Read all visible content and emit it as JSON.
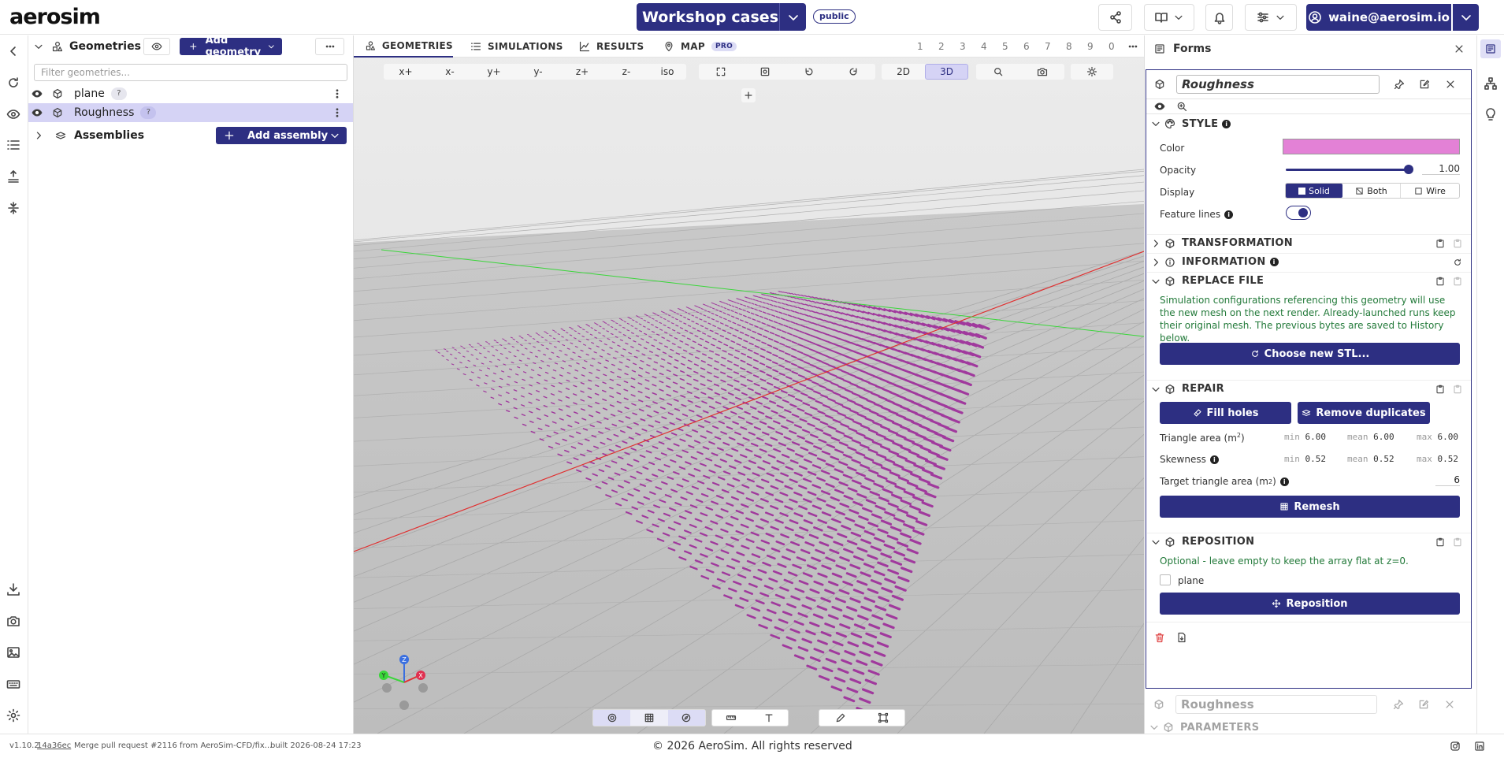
{
  "topbar": {
    "logo": "aerosim",
    "project_title": "Workshop cases",
    "visibility_badge": "public",
    "user_email": "waine@aerosim.io"
  },
  "geometries_panel": {
    "title": "Geometries",
    "add_geometry_label": "Add geometry",
    "filter_placeholder": "Filter geometries...",
    "items": [
      {
        "name": "plane",
        "badge": "?"
      },
      {
        "name": "Roughness",
        "badge": "?"
      }
    ],
    "assemblies_label": "Assemblies",
    "add_assembly_label": "Add assembly"
  },
  "viewport": {
    "tabs": [
      {
        "label": "GEOMETRIES"
      },
      {
        "label": "SIMULATIONS"
      },
      {
        "label": "RESULTS"
      },
      {
        "label": "MAP",
        "badge": "PRO"
      }
    ],
    "numbers": [
      "1",
      "2",
      "3",
      "4",
      "5",
      "6",
      "7",
      "8",
      "9",
      "0"
    ],
    "view_buttons": [
      "x+",
      "x-",
      "y+",
      "y-",
      "z+",
      "z-",
      "iso"
    ],
    "mode_2d": "2D",
    "mode_3d": "3D",
    "axis_labels": {
      "z": "Z",
      "y": "Y",
      "x": "X"
    },
    "colors": {
      "roughness_dots": "#a0399d",
      "x_axis": "#e03030",
      "y_axis": "#3ad63a",
      "z_axis": "#3a6fe0"
    }
  },
  "forms": {
    "title": "Forms",
    "geometry_name": "Roughness",
    "style": {
      "header": "STYLE",
      "color_label": "Color",
      "color_value": "#e381d6",
      "opacity_label": "Opacity",
      "opacity_value": "1.00",
      "display_label": "Display",
      "display_options": [
        "Solid",
        "Both",
        "Wire"
      ],
      "display_selected": "Solid",
      "feature_lines_label": "Feature lines",
      "feature_lines_on": true
    },
    "transformation_header": "TRANSFORMATION",
    "information_header": "INFORMATION",
    "replace_file": {
      "header": "REPLACE FILE",
      "note": "Simulation configurations referencing this geometry will use the new mesh on the next render. Already-launched runs keep their original mesh. The previous bytes are saved to History below.",
      "button": "Choose new STL..."
    },
    "repair": {
      "header": "REPAIR",
      "fill_holes": "Fill holes",
      "remove_duplicates": "Remove duplicates",
      "triangle_area_label": "Triangle area (m",
      "sup2": "2",
      "close_paren": ")",
      "skewness_label": "Skewness",
      "target_label_a": "Target triangle area (m",
      "target_label_b": ")",
      "target_value": "6",
      "stat_min": "min",
      "stat_mean": "mean",
      "stat_max": "max",
      "tri_min": "6.00",
      "tri_mean": "6.00",
      "tri_max": "6.00",
      "skew_min": "0.52",
      "skew_mean": "0.52",
      "skew_max": "0.52",
      "remesh": "Remesh"
    },
    "reposition": {
      "header": "REPOSITION",
      "note": "Optional - leave empty to keep the array flat at z=0.",
      "option": "plane",
      "button": "Reposition"
    },
    "second_card": {
      "name": "Roughness",
      "section": "PARAMETERS"
    }
  },
  "bottombar": {
    "version": "v1.10.2",
    "commit": "14a36ec",
    "message": "Merge pull request #2116 from AeroSim-CFD/fix...",
    "built": "built 2026-08-24 17:23",
    "copyright": "© 2026 AeroSim. All rights reserved"
  }
}
